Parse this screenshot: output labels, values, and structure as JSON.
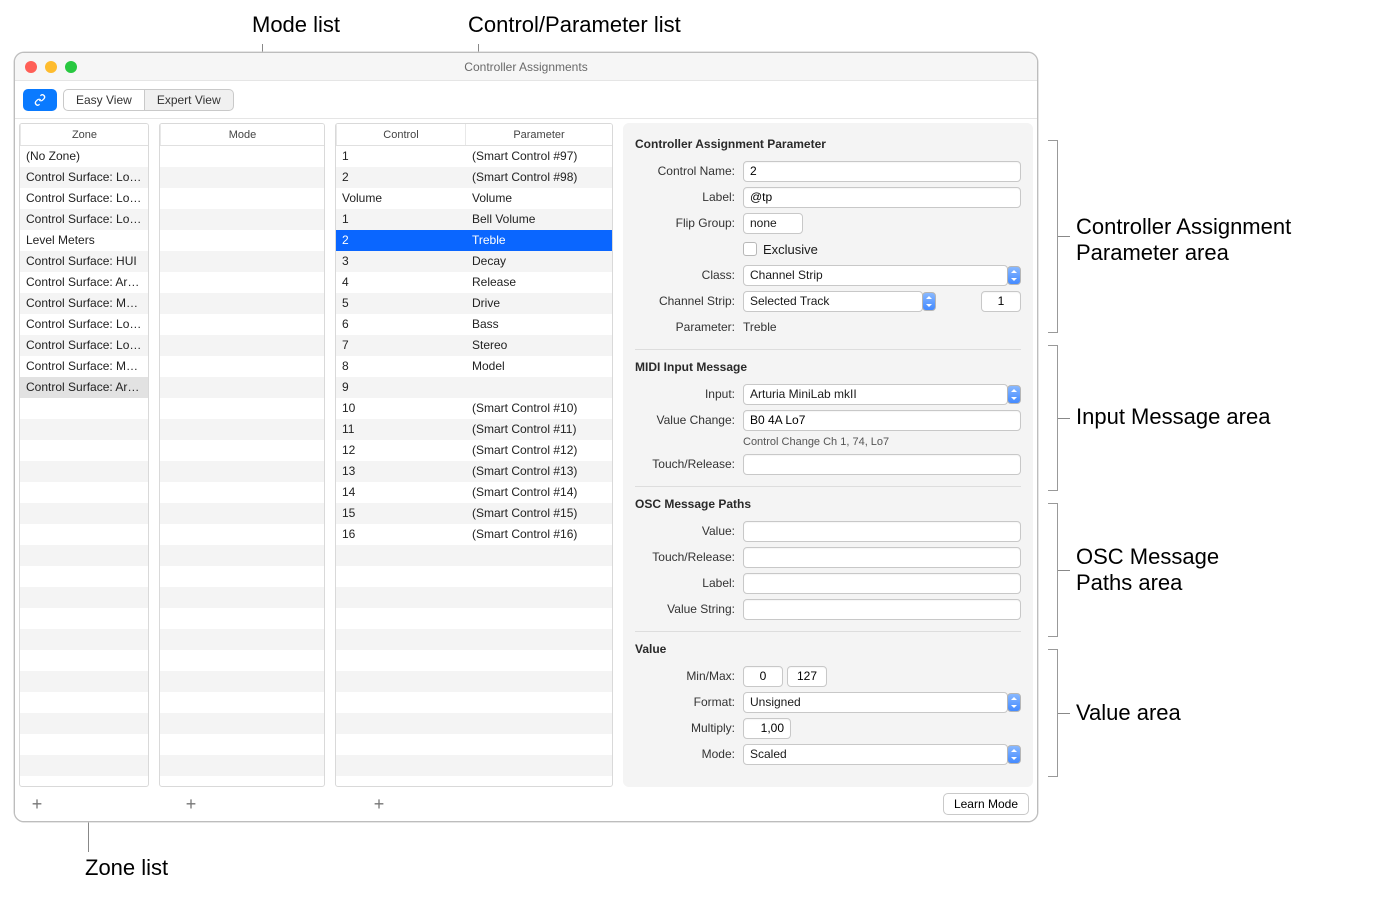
{
  "annotations": {
    "mode_list": "Mode list",
    "control_list": "Control/Parameter list",
    "zone_list": "Zone list",
    "param_area": "Controller Assignment Parameter area",
    "input_area": "Input Message area",
    "osc_area": "OSC Message Paths area",
    "value_area": "Value area"
  },
  "window_title": "Controller Assignments",
  "toolbar": {
    "easy": "Easy View",
    "expert": "Expert View"
  },
  "headers": {
    "zone": "Zone",
    "mode": "Mode",
    "control": "Control",
    "parameter": "Parameter"
  },
  "zones": [
    {
      "label": "(No Zone)",
      "sel": ""
    },
    {
      "label": "Control Surface: Log…",
      "sel": ""
    },
    {
      "label": "Control Surface: Log…",
      "sel": ""
    },
    {
      "label": "Control Surface: Log…",
      "sel": ""
    },
    {
      "label": "Level Meters",
      "sel": ""
    },
    {
      "label": "Control Surface: HUI",
      "sel": ""
    },
    {
      "label": "Control Surface: Art…",
      "sel": ""
    },
    {
      "label": "Control Surface: Ma…",
      "sel": ""
    },
    {
      "label": "Control Surface: Log…",
      "sel": ""
    },
    {
      "label": "Control Surface: Log…",
      "sel": ""
    },
    {
      "label": "Control Surface: Ma…",
      "sel": ""
    },
    {
      "label": "Control Surface: Art…",
      "sel": "soft"
    }
  ],
  "controls": [
    {
      "c": "1",
      "p": "(Smart Control #97)",
      "sel": ""
    },
    {
      "c": "2",
      "p": "(Smart Control #98)",
      "sel": ""
    },
    {
      "c": "Volume",
      "p": "Volume",
      "sel": ""
    },
    {
      "c": "1",
      "p": "Bell Volume",
      "sel": ""
    },
    {
      "c": "2",
      "p": "Treble",
      "sel": "hard"
    },
    {
      "c": "3",
      "p": "Decay",
      "sel": ""
    },
    {
      "c": "4",
      "p": "Release",
      "sel": ""
    },
    {
      "c": "5",
      "p": "Drive",
      "sel": ""
    },
    {
      "c": "6",
      "p": "Bass",
      "sel": ""
    },
    {
      "c": "7",
      "p": "Stereo",
      "sel": ""
    },
    {
      "c": "8",
      "p": "Model",
      "sel": ""
    },
    {
      "c": "9",
      "p": "",
      "sel": ""
    },
    {
      "c": "10",
      "p": "(Smart Control #10)",
      "sel": ""
    },
    {
      "c": "11",
      "p": "(Smart Control #11)",
      "sel": ""
    },
    {
      "c": "12",
      "p": "(Smart Control #12)",
      "sel": ""
    },
    {
      "c": "13",
      "p": "(Smart Control #13)",
      "sel": ""
    },
    {
      "c": "14",
      "p": "(Smart Control #14)",
      "sel": ""
    },
    {
      "c": "15",
      "p": "(Smart Control #15)",
      "sel": ""
    },
    {
      "c": "16",
      "p": "(Smart Control #16)",
      "sel": ""
    }
  ],
  "param": {
    "section_title": "Controller Assignment Parameter",
    "control_name_label": "Control Name:",
    "control_name": "2",
    "label_label": "Label:",
    "label": "@tp",
    "flip_group_label": "Flip Group:",
    "flip_group": "none",
    "exclusive_label": "Exclusive",
    "class_label": "Class:",
    "class": "Channel Strip",
    "channel_strip_label": "Channel Strip:",
    "channel_strip": "Selected Track",
    "channel_strip_num": "1",
    "parameter_label": "Parameter:",
    "parameter": "Treble"
  },
  "midi": {
    "section_title": "MIDI Input Message",
    "input_label": "Input:",
    "input": "Arturia MiniLab mkII",
    "value_change_label": "Value Change:",
    "value_change": "B0 4A Lo7",
    "value_change_desc": "Control Change Ch 1, 74, Lo7",
    "touch_release_label": "Touch/Release:"
  },
  "osc": {
    "section_title": "OSC Message Paths",
    "value_label": "Value:",
    "touch_release_label": "Touch/Release:",
    "label_label": "Label:",
    "value_string_label": "Value String:"
  },
  "value": {
    "section_title": "Value",
    "minmax_label": "Min/Max:",
    "min": "0",
    "max": "127",
    "format_label": "Format:",
    "format": "Unsigned",
    "multiply_label": "Multiply:",
    "multiply": "1,00",
    "mode_label": "Mode:",
    "mode": "Scaled"
  },
  "learn_mode": "Learn Mode"
}
